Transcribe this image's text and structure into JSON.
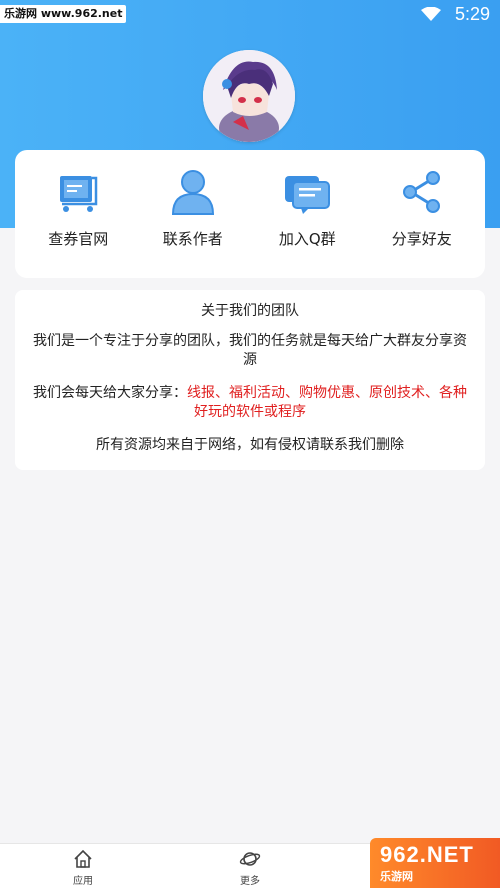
{
  "colors": {
    "brand": "#3a9ff1",
    "icon_blue": "#3b8fe2",
    "highlight_red": "#e02020"
  },
  "statusbar": {
    "watermark": "乐游网 www.962.net",
    "time": "5:29"
  },
  "menu": [
    {
      "label": "查券官网",
      "icon": "cart-icon"
    },
    {
      "label": "联系作者",
      "icon": "person-icon"
    },
    {
      "label": "加入Q群",
      "icon": "chat-icon"
    },
    {
      "label": "分享好友",
      "icon": "share-icon"
    }
  ],
  "about": {
    "title": "关于我们的团队",
    "intro": "我们是一个专注于分享的团队，我们的任务就是每天给广大群友分享资源",
    "share_prefix": "我们会每天给大家分享：",
    "share_items": "线报、福利活动、购物优惠、原创技术、各种好玩的软件或程序",
    "disclaimer": "所有资源均来自于网络，如有侵权请联系我们删除"
  },
  "nav": [
    {
      "label": "应用",
      "icon": "home-icon"
    },
    {
      "label": "更多",
      "icon": "planet-icon"
    }
  ],
  "corner_logo": {
    "line1": "962.NET",
    "line2": "乐游网"
  }
}
